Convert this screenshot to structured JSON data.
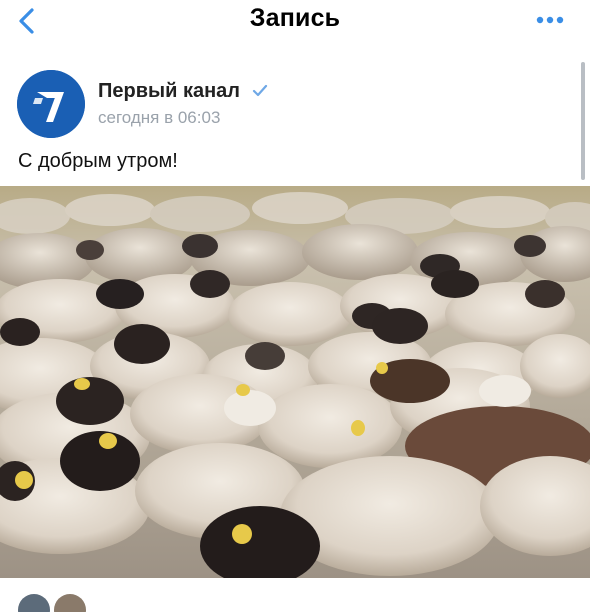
{
  "header": {
    "title": "Запись",
    "back_icon": "chevron-left-icon",
    "more_icon": "more-horizontal-icon",
    "accent": "#3a8ee6"
  },
  "post": {
    "author": "Первый канал",
    "verified": true,
    "time": "сегодня в 06:03",
    "text": "С добрым утром!",
    "avatar_color": "#1a5fb4",
    "photo_subject": "flock-of-sheep-photo"
  }
}
